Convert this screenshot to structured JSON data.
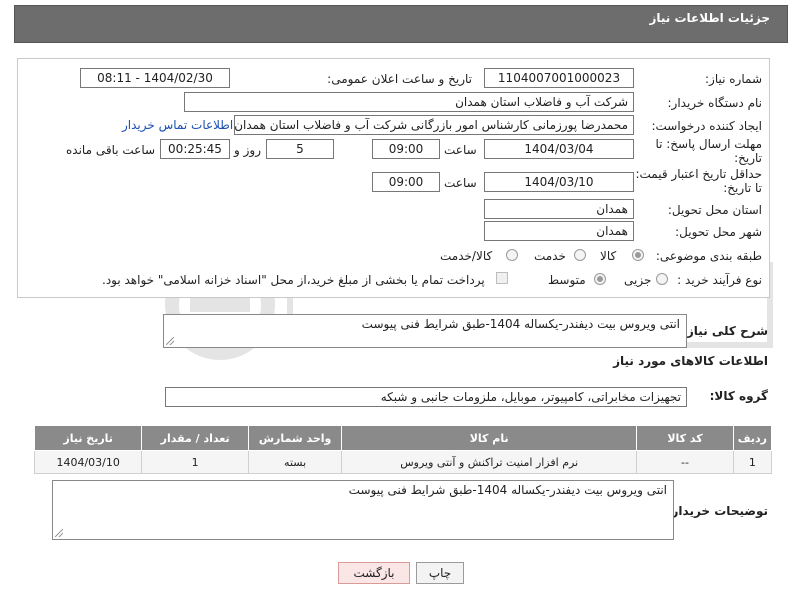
{
  "header": {
    "title": "جزئیات اطلاعات نیاز"
  },
  "form": {
    "need_number_label": "شماره نیاز:",
    "need_number": "1104007001000023",
    "announce_label": "تاریخ و ساعت اعلان عمومی:",
    "announce_value": "1404/02/30 - 08:11",
    "buyer_org_label": "نام دستگاه خریدار:",
    "buyer_org": "شرکت آب و فاضلاب استان همدان",
    "creator_label": "ایجاد کننده درخواست:",
    "creator": "محمدرضا پورزمانی کارشناس امور بازرگانی شرکت آب و فاضلاب استان همدان",
    "buyer_contact_link": "اطلاعات تماس خریدار",
    "deadline_label_1": "مهلت ارسال پاسخ: تا",
    "deadline_label_2": "تاریخ:",
    "deadline_date": "1404/03/04",
    "time_label": "ساعت",
    "deadline_time": "09:00",
    "days_value": "5",
    "days_label": "روز و",
    "remaining_time": "00:25:45",
    "remaining_label": "ساعت باقی مانده",
    "min_price_label_1": "حداقل تاریخ اعتبار قیمت:",
    "min_price_label_2": "تا تاریخ:",
    "min_price_date": "1404/03/10",
    "min_price_time": "09:00",
    "province_label": "استان محل تحویل:",
    "province": "همدان",
    "city_label": "شهر محل تحویل:",
    "city": "همدان",
    "category_label": "طبقه بندی موضوعی:",
    "category_options": [
      "کالا",
      "خدمت",
      "کالا/خدمت"
    ],
    "process_label": "نوع فرآیند خرید :",
    "process_options": [
      "جزیی",
      "متوسط"
    ],
    "payment_note": "پرداخت تمام یا بخشی از مبلغ خرید،از محل \"اسناد خزانه اسلامی\" خواهد بود."
  },
  "description": {
    "label": "شرح کلی نیاز:",
    "text": "انتی ویروس بیت دیفندر-یکساله 1404-طبق شرایط فنی پیوست"
  },
  "goods": {
    "section_title": "اطلاعات کالاهای مورد نیاز",
    "group_label": "گروه کالا:",
    "group_value": "تجهیزات مخابراتی، کامپیوتر، موبایل، ملزومات جانبی و شبکه",
    "columns": [
      "ردیف",
      "کد کالا",
      "نام کالا",
      "واحد شمارش",
      "تعداد / مقدار",
      "تاریخ نیاز"
    ],
    "rows": [
      [
        "1",
        "--",
        "نرم افزار امنیت تراکنش و آنتی ویروس",
        "بسته",
        "1",
        "1404/03/10"
      ]
    ]
  },
  "buyer_notes": {
    "label": "توضیحات خریدار:",
    "text": "انتی ویروس بیت دیفندر-یکساله 1404-طبق شرایط فنی پیوست"
  },
  "buttons": {
    "print": "چاپ",
    "back": "بازگشت"
  }
}
